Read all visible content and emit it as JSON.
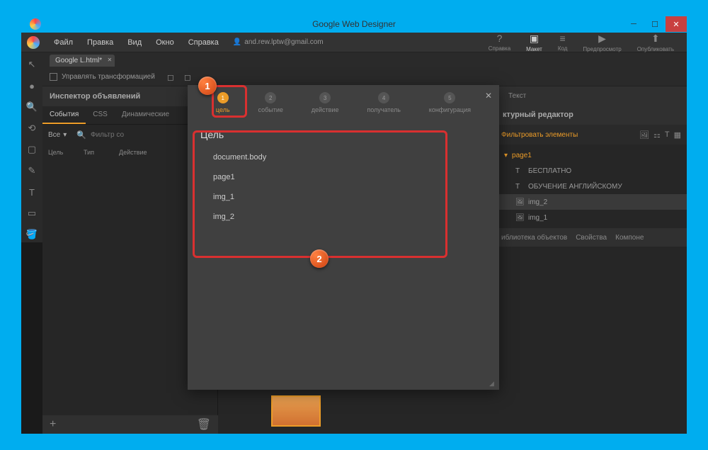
{
  "titlebar": {
    "title": "Google Web Designer"
  },
  "menubar": {
    "items": [
      "Файл",
      "Правка",
      "Вид",
      "Окно",
      "Справка"
    ],
    "user_email": "and.rew.lptw@gmail.com"
  },
  "top_actions": [
    {
      "label": "Справка",
      "icon": "?"
    },
    {
      "label": "Макет",
      "icon": "▣"
    },
    {
      "label": "Код",
      "icon": "≡"
    },
    {
      "label": "Предпросмотр",
      "icon": "▶"
    },
    {
      "label": "Опубликовать",
      "icon": "⬆"
    }
  ],
  "doc_tab": {
    "name": "Google L.html*"
  },
  "toolbar": {
    "transform_label": "Управлять трансформацией"
  },
  "left_panel": {
    "title": "Инспектор объявлений",
    "tabs": [
      "События",
      "CSS",
      "Динамические"
    ],
    "filter_all": "Все",
    "filter_placeholder": "Фильтр со",
    "cols": [
      "Цель",
      "Тип",
      "Действие"
    ]
  },
  "right_panel": {
    "tabs_top": [
      "",
      "Текст"
    ],
    "section_title": "ктурный редактор",
    "filter_label": "Фильтровать элементы",
    "tree_root": "page1",
    "tree_items": [
      {
        "icon": "T",
        "label": "БЕСПЛАТНО"
      },
      {
        "icon": "T",
        "label": "ОБУЧЕНИЕ АНГЛИЙСКОМУ"
      },
      {
        "icon": "🖼",
        "label": "img_2"
      },
      {
        "icon": "🖼",
        "label": "img_1"
      }
    ],
    "bottom_tabs": [
      "иблиотека объектов",
      "Свойства",
      "Компоне"
    ]
  },
  "modal": {
    "steps": [
      {
        "num": "1",
        "label": "цель"
      },
      {
        "num": "2",
        "label": "событие"
      },
      {
        "num": "3",
        "label": "действие"
      },
      {
        "num": "4",
        "label": "получатель"
      },
      {
        "num": "5",
        "label": "конфигурация"
      }
    ],
    "body_title": "Цель",
    "targets": [
      "document.body",
      "page1",
      "img_1",
      "img_2"
    ]
  },
  "annotations": {
    "a1": "1",
    "a2": "2"
  }
}
